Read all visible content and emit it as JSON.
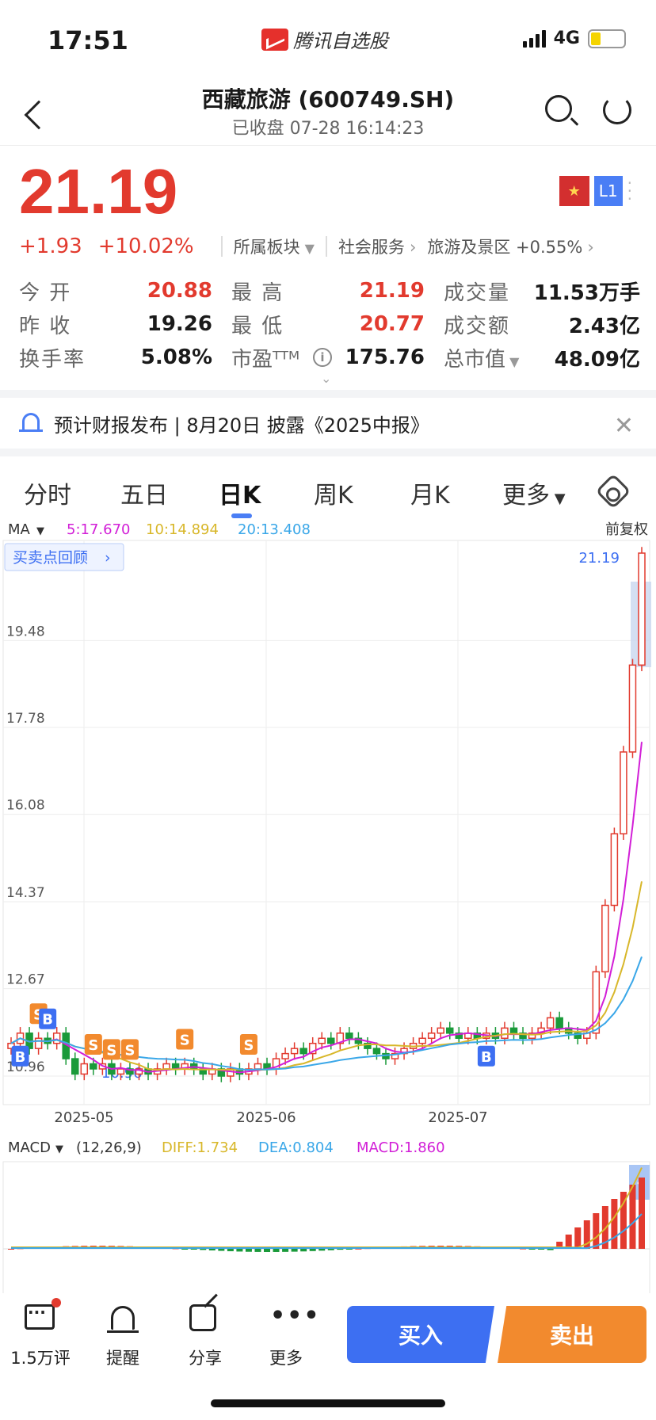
{
  "status": {
    "time": "17:51",
    "app_name": "腾讯自选股",
    "network": "4G"
  },
  "nav": {
    "title": "西藏旅游 (600749.SH)",
    "subtitle": "已收盘   07-28 16:14:23"
  },
  "quote": {
    "price": "21.19",
    "change": "+1.93",
    "change_pct": "+10.02%",
    "sector_label": "所属板块",
    "sector1": "社会服务",
    "sector2": "旅游及景区 +0.55%",
    "badge": "L1",
    "flag": "★"
  },
  "stats": {
    "open_label": "今  开",
    "open": "20.88",
    "high_label": "最  高",
    "high": "21.19",
    "volume_label": "成交量",
    "volume": "11.53万手",
    "prev_close_label": "昨  收",
    "prev_close": "19.26",
    "low_label": "最  低",
    "low": "20.77",
    "amount_label": "成交额",
    "amount": "2.43亿",
    "turnover_label": "换手率",
    "turnover": "5.08%",
    "pe_label": "市盈ᵀᵀᴹ",
    "pe_info": "i",
    "pe": "175.76",
    "mktcap_label": "总市值",
    "mktcap": "48.09亿"
  },
  "notice": {
    "text": "预计财报发布 | 8月20日 披露《2025中报》"
  },
  "tabs": [
    "分时",
    "五日",
    "日K",
    "周K",
    "月K",
    "更多"
  ],
  "chart": {
    "ma_label": "MA",
    "ma5": "5:17.670",
    "ma10": "10:14.894",
    "ma20": "20:13.408",
    "adjust": "前复权",
    "review_btn": "买卖点回顾",
    "price_tag": "21.19",
    "low_tag": "10.96",
    "y_ticks": [
      "19.48",
      "17.78",
      "16.08",
      "14.37",
      "12.67",
      "10.96"
    ],
    "x_ticks": [
      "2025-05",
      "2025-06",
      "2025-07"
    ],
    "macd_label": "MACD",
    "macd_params": "(12,26,9)",
    "diff": "DIFF:1.734",
    "dea": "DEA:0.804",
    "macd": "MACD:1.860",
    "colors": {
      "up": "#e23a2e",
      "down": "#1a9a3a",
      "ma5": "#d21fd7",
      "ma10": "#d8b72a",
      "ma20": "#3aa7e8"
    }
  },
  "chart_data": {
    "type": "candlestick",
    "ylim": [
      10.96,
      21.19
    ],
    "closes": [
      11.6,
      11.8,
      11.5,
      11.7,
      11.6,
      11.8,
      11.3,
      11.0,
      11.2,
      11.1,
      11.2,
      11.0,
      11.1,
      11.0,
      11.1,
      11.0,
      11.1,
      11.2,
      11.1,
      11.2,
      11.1,
      11.0,
      11.1,
      10.96,
      11.1,
      11.0,
      11.1,
      11.2,
      11.1,
      11.3,
      11.4,
      11.5,
      11.4,
      11.6,
      11.7,
      11.6,
      11.8,
      11.7,
      11.6,
      11.5,
      11.4,
      11.3,
      11.4,
      11.5,
      11.6,
      11.7,
      11.8,
      11.9,
      11.8,
      11.7,
      11.8,
      11.7,
      11.8,
      11.7,
      11.9,
      11.8,
      11.7,
      11.8,
      11.9,
      12.1,
      11.9,
      11.8,
      11.7,
      11.8,
      13.0,
      14.3,
      15.7,
      17.3,
      19.0,
      21.19
    ]
  },
  "bottom": {
    "comments": "1.5万评",
    "alert": "提醒",
    "share": "分享",
    "more": "更多",
    "buy": "买入",
    "sell": "卖出"
  }
}
